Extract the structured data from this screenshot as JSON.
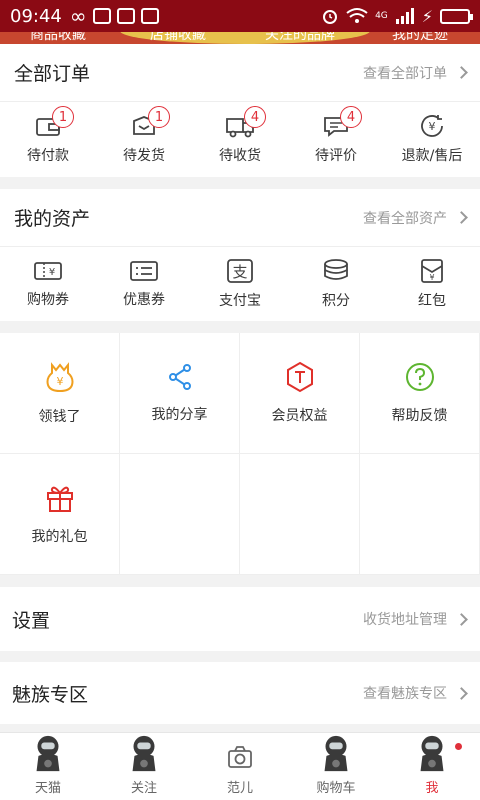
{
  "status_bar": {
    "time": "09:44",
    "network": "4G"
  },
  "banner": {
    "items": [
      "商品收藏",
      "店铺收藏",
      "关注的品牌",
      "我的足迹"
    ]
  },
  "orders": {
    "title": "全部订单",
    "link": "查看全部订单",
    "items": [
      {
        "label": "待付款",
        "icon": "wallet-icon",
        "badge": "1"
      },
      {
        "label": "待发货",
        "icon": "package-icon",
        "badge": "1"
      },
      {
        "label": "待收货",
        "icon": "truck-icon",
        "badge": "4"
      },
      {
        "label": "待评价",
        "icon": "comment-icon",
        "badge": "4"
      },
      {
        "label": "退款/售后",
        "icon": "refund-icon",
        "badge": ""
      }
    ]
  },
  "assets": {
    "title": "我的资产",
    "link": "查看全部资产",
    "items": [
      {
        "label": "购物券",
        "icon": "voucher-icon"
      },
      {
        "label": "优惠券",
        "icon": "coupon-icon"
      },
      {
        "label": "支付宝",
        "icon": "alipay-icon"
      },
      {
        "label": "积分",
        "icon": "points-icon"
      },
      {
        "label": "红包",
        "icon": "red-envelope-icon"
      }
    ]
  },
  "tools": [
    {
      "label": "领钱了",
      "icon": "money-bag-icon",
      "color": "#f0a020"
    },
    {
      "label": "我的分享",
      "icon": "share-icon",
      "color": "#2f8fe6"
    },
    {
      "label": "会员权益",
      "icon": "member-icon",
      "color": "#e0302a"
    },
    {
      "label": "帮助反馈",
      "icon": "help-icon",
      "color": "#5db530"
    },
    {
      "label": "我的礼包",
      "icon": "gift-icon",
      "color": "#e0302a"
    }
  ],
  "settings": {
    "title": "设置",
    "link": "收货地址管理"
  },
  "meizu": {
    "title": "魅族专区",
    "link": "查看魅族专区"
  },
  "bottom_nav": [
    {
      "label": "天猫",
      "icon": "tmall-mascot-icon"
    },
    {
      "label": "关注",
      "icon": "follow-mascot-icon"
    },
    {
      "label": "范儿",
      "icon": "camera-icon"
    },
    {
      "label": "购物车",
      "icon": "cart-mascot-icon"
    },
    {
      "label": "我",
      "icon": "me-mascot-icon"
    }
  ],
  "colors": {
    "status_bar": "#8b0a14",
    "accent": "#e0303a"
  }
}
